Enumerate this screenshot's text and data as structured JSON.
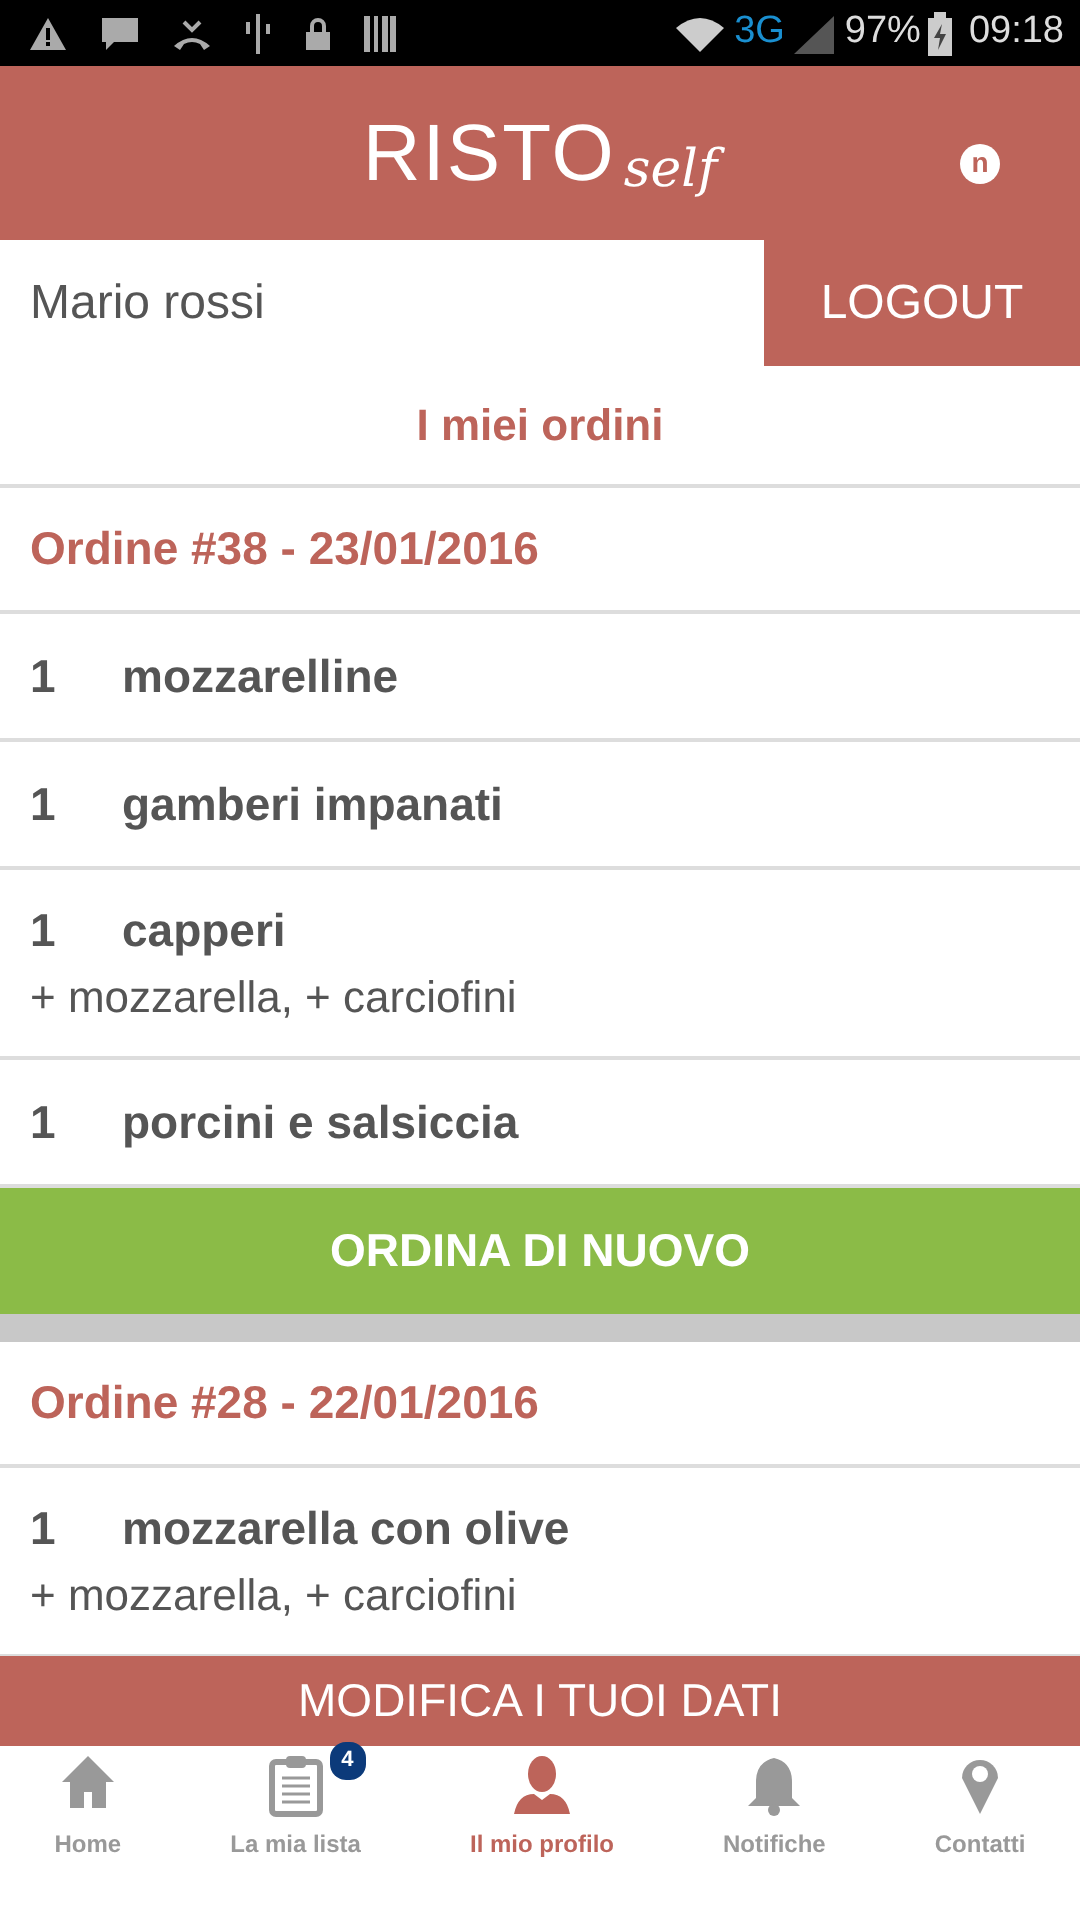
{
  "status_bar": {
    "network": "3G",
    "battery": "97%",
    "time": "09:18"
  },
  "header": {
    "logo_main": "RISTO",
    "logo_script": "self",
    "notification_badge": "n"
  },
  "user": {
    "name": "Mario rossi",
    "logout": "LOGOUT"
  },
  "section_title": "I miei ordini",
  "orders": [
    {
      "title": "Ordine #38 - 23/01/2016",
      "items": [
        {
          "qty": "1",
          "name": "mozzarelline"
        },
        {
          "qty": "1",
          "name": "gamberi impanati"
        },
        {
          "qty": "1",
          "name": "capperi",
          "extras": "+ mozzarella, + carciofini"
        },
        {
          "qty": "1",
          "name": "porcini e salsiccia"
        }
      ],
      "reorder": "ORDINA DI NUOVO"
    },
    {
      "title": "Ordine #28 - 22/01/2016",
      "items": [
        {
          "qty": "1",
          "name": "mozzarella con olive",
          "extras": "+ mozzarella, + carciofini"
        }
      ]
    }
  ],
  "edit_button": "MODIFICA I TUOI DATI",
  "tabs": [
    {
      "kind": "home",
      "label": "Home",
      "selected": false
    },
    {
      "kind": "list",
      "label": "La mia lista",
      "selected": false,
      "badge": "4"
    },
    {
      "kind": "profile",
      "label": "Il mio profilo",
      "selected": true
    },
    {
      "kind": "bell",
      "label": "Notifiche",
      "selected": false
    },
    {
      "kind": "pin",
      "label": "Contatti",
      "selected": false
    }
  ]
}
